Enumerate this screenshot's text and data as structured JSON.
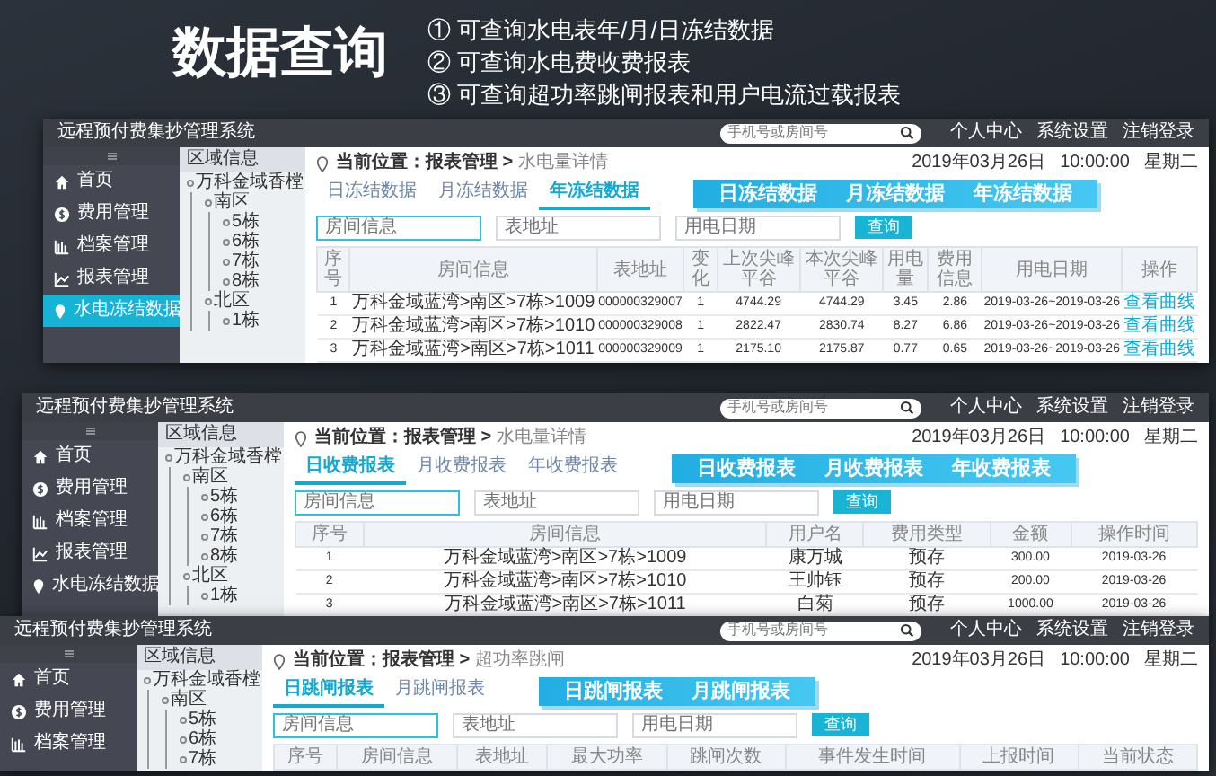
{
  "headline": {
    "title": "数据查询",
    "points": [
      "① 可查询水电表年/月/日冻结数据",
      "② 可查询水电费收费报表",
      "③ 可查询超功率跳闸报表和用户电流过载报表"
    ]
  },
  "windows": [
    {
      "app_title": "远程预付费集抄管理系统",
      "search": {
        "placeholder": "手机号或房间号"
      },
      "header_links": [
        "个人中心",
        "系统设置",
        "注销登录"
      ],
      "sidebar": [
        {
          "label": "首页",
          "selected": false
        },
        {
          "label": "费用管理",
          "selected": false
        },
        {
          "label": "档案管理",
          "selected": false
        },
        {
          "label": "报表管理",
          "selected": false
        },
        {
          "label": "水电冻结数据",
          "selected": true
        }
      ],
      "tree": {
        "title": "区域信息",
        "nodes": [
          {
            "label": "万科金域香樘",
            "children": [
              {
                "label": "南区",
                "children": [
                  {
                    "label": "5栋"
                  },
                  {
                    "label": "6栋"
                  },
                  {
                    "label": "7栋"
                  },
                  {
                    "label": "8栋"
                  }
                ]
              },
              {
                "label": "北区",
                "children": [
                  {
                    "label": "1栋"
                  }
                ]
              }
            ]
          }
        ]
      },
      "breadcrumb": "**当前位置：报表管理 >** 水电量详情",
      "date": "2019年03月26日",
      "time": "10:00:00",
      "weekday": "星期二",
      "tabs": [
        {
          "label": "日冻结数据",
          "selected": false
        },
        {
          "label": "月冻结数据",
          "selected": false
        },
        {
          "label": "年冻结数据",
          "selected": true
        }
      ],
      "callout": [
        "日冻结数据",
        "月冻结数据",
        "年冻结数据"
      ],
      "filters": [
        {
          "placeholder": "房间信息",
          "focused": true
        },
        {
          "placeholder": "表地址",
          "focused": false
        },
        {
          "placeholder": "用电日期",
          "focused": false
        }
      ],
      "query_button": "查询",
      "table": {
        "columns": [
          {
            "label": "序号",
            "kind": "text"
          },
          {
            "label": "房间信息",
            "kind": "text"
          },
          {
            "label": "表地址",
            "kind": "text"
          },
          {
            "label": "变化",
            "kind": "text"
          },
          {
            "label": "上次尖峰平谷",
            "kind": "text"
          },
          {
            "label": "本次尖峰平谷",
            "kind": "text"
          },
          {
            "label": "用电量",
            "kind": "text"
          },
          {
            "label": "费用信息",
            "kind": "text"
          },
          {
            "label": "用电日期",
            "kind": "text"
          },
          {
            "label": "操作",
            "kind": "link"
          }
        ],
        "rows": [
          [
            "1",
            "万科金域蓝湾>南区>7栋>1009",
            "000000329007",
            "1",
            "4744.29",
            "4744.29",
            "3.45",
            "2.86",
            "2019-03-26~2019-03-26",
            "查看曲线"
          ],
          [
            "2",
            "万科金域蓝湾>南区>7栋>1010",
            "000000329008",
            "1",
            "2822.47",
            "2830.74",
            "8.27",
            "6.86",
            "2019-03-26~2019-03-26",
            "查看曲线"
          ],
          [
            "3",
            "万科金域蓝湾>南区>7栋>1011",
            "000000329009",
            "1",
            "2175.10",
            "2175.87",
            "0.77",
            "0.65",
            "2019-03-26~2019-03-26",
            "查看曲线"
          ]
        ]
      }
    },
    {
      "app_title": "远程预付费集抄管理系统",
      "search": {
        "placeholder": "手机号或房间号"
      },
      "header_links": [
        "个人中心",
        "系统设置",
        "注销登录"
      ],
      "sidebar": [
        {
          "label": "首页",
          "selected": false
        },
        {
          "label": "费用管理",
          "selected": false
        },
        {
          "label": "档案管理",
          "selected": false
        },
        {
          "label": "报表管理",
          "selected": false
        },
        {
          "label": "水电冻结数据",
          "selected": false
        }
      ],
      "tree": {
        "title": "区域信息",
        "nodes": [
          {
            "label": "万科金域香樘",
            "children": [
              {
                "label": "南区",
                "children": [
                  {
                    "label": "5栋"
                  },
                  {
                    "label": "6栋"
                  },
                  {
                    "label": "7栋"
                  },
                  {
                    "label": "8栋"
                  }
                ]
              },
              {
                "label": "北区",
                "children": [
                  {
                    "label": "1栋"
                  }
                ]
              }
            ]
          }
        ]
      },
      "breadcrumb": "**当前位置：报表管理 >** 水电量详情",
      "date": "2019年03月26日",
      "time": "10:00:00",
      "weekday": "星期二",
      "tabs": [
        {
          "label": "日收费报表",
          "selected": true
        },
        {
          "label": "月收费报表",
          "selected": false
        },
        {
          "label": "年收费报表",
          "selected": false
        }
      ],
      "callout": [
        "日收费报表",
        "月收费报表",
        "年收费报表"
      ],
      "filters": [
        {
          "placeholder": "房间信息",
          "focused": true
        },
        {
          "placeholder": "表地址",
          "focused": false
        },
        {
          "placeholder": "用电日期",
          "focused": false
        }
      ],
      "query_button": "查询",
      "table": {
        "columns": [
          {
            "label": "序号",
            "kind": "text"
          },
          {
            "label": "房间信息",
            "kind": "text"
          },
          {
            "label": "用户名",
            "kind": "text"
          },
          {
            "label": "费用类型",
            "kind": "text"
          },
          {
            "label": "金额",
            "kind": "text"
          },
          {
            "label": "操作时间",
            "kind": "text"
          }
        ],
        "rows": [
          [
            "1",
            "万科金域蓝湾>南区>7栋>1009",
            "康万城",
            "预存",
            "300.00",
            "2019-03-26"
          ],
          [
            "2",
            "万科金域蓝湾>南区>7栋>1010",
            "王帅钰",
            "预存",
            "200.00",
            "2019-03-26"
          ],
          [
            "3",
            "万科金域蓝湾>南区>7栋>1011",
            "白菊",
            "预存",
            "1000.00",
            "2019-03-26"
          ]
        ]
      }
    },
    {
      "app_title": "远程预付费集抄管理系统",
      "search": {
        "placeholder": "手机号或房间号"
      },
      "header_links": [
        "个人中心",
        "系统设置",
        "注销登录"
      ],
      "sidebar": [
        {
          "label": "首页",
          "selected": false
        },
        {
          "label": "费用管理",
          "selected": false
        },
        {
          "label": "档案管理",
          "selected": false
        }
      ],
      "tree": {
        "title": "区域信息",
        "nodes": [
          {
            "label": "万科金域香樘",
            "children": [
              {
                "label": "南区",
                "children": [
                  {
                    "label": "5栋"
                  },
                  {
                    "label": "6栋"
                  },
                  {
                    "label": "7栋"
                  }
                ]
              }
            ]
          }
        ]
      },
      "breadcrumb": "**当前位置：报表管理 >** 超功率跳闸",
      "date": "2019年03月26日",
      "time": "10:00:00",
      "weekday": "星期二",
      "tabs": [
        {
          "label": "日跳闸报表",
          "selected": true
        },
        {
          "label": "月跳闸报表",
          "selected": false
        }
      ],
      "callout": [
        "日跳闸报表",
        "月跳闸报表"
      ],
      "filters": [
        {
          "placeholder": "房间信息",
          "focused": true
        },
        {
          "placeholder": "表地址",
          "focused": false
        },
        {
          "placeholder": "用电日期",
          "focused": false
        }
      ],
      "query_button": "查询",
      "table": {
        "columns": [
          {
            "label": "序号"
          },
          {
            "label": "房间信息"
          },
          {
            "label": "表地址"
          },
          {
            "label": "最大功率"
          },
          {
            "label": "跳闸次数"
          },
          {
            "label": "事件发生时间"
          },
          {
            "label": "上报时间"
          },
          {
            "label": "当前状态"
          }
        ]
      }
    }
  ]
}
